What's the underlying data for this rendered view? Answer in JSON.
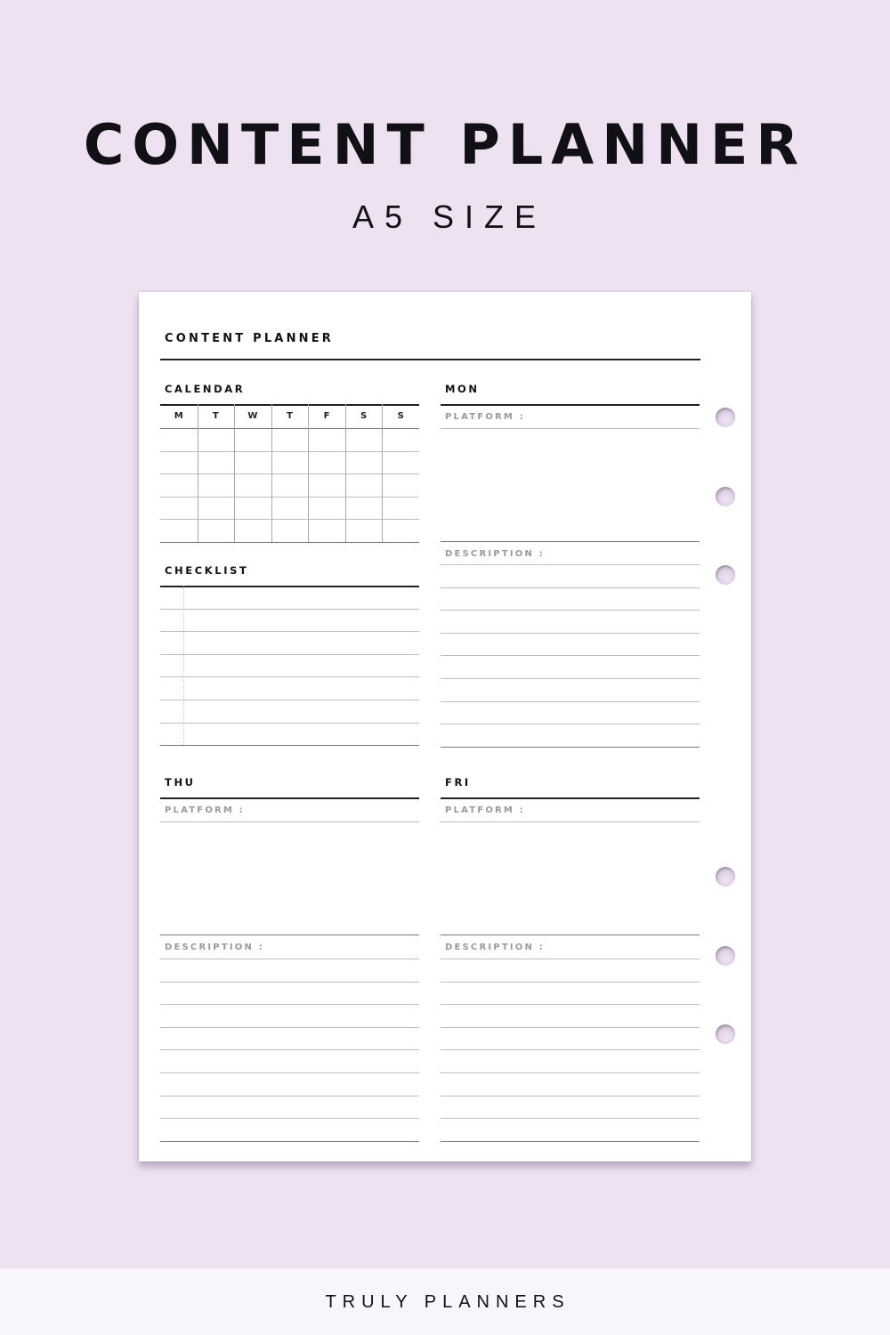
{
  "header": {
    "title": "CONTENT PLANNER",
    "subtitle": "A5 SIZE"
  },
  "page": {
    "title": "CONTENT PLANNER",
    "calendar": {
      "label": "CALENDAR",
      "weekdays": [
        "M",
        "T",
        "W",
        "T",
        "F",
        "S",
        "S"
      ],
      "rows": 5
    },
    "checklist": {
      "label": "CHECKLIST",
      "lines": 7
    },
    "days": [
      {
        "name": "MON",
        "platform_label": "PLATFORM :",
        "description_label": "DESCRIPTION :"
      },
      {
        "name": "THU",
        "platform_label": "PLATFORM :",
        "description_label": "DESCRIPTION :"
      },
      {
        "name": "FRI",
        "platform_label": "PLATFORM :",
        "description_label": "DESCRIPTION :"
      }
    ],
    "ring_holes": 6
  },
  "footer": {
    "brand": "TRULY PLANNERS"
  },
  "colors": {
    "background": "#ede1f2",
    "paper": "#ffffff",
    "footer_background": "#f8f6fa",
    "text": "#111111",
    "muted_label": "#9a9a9a"
  }
}
